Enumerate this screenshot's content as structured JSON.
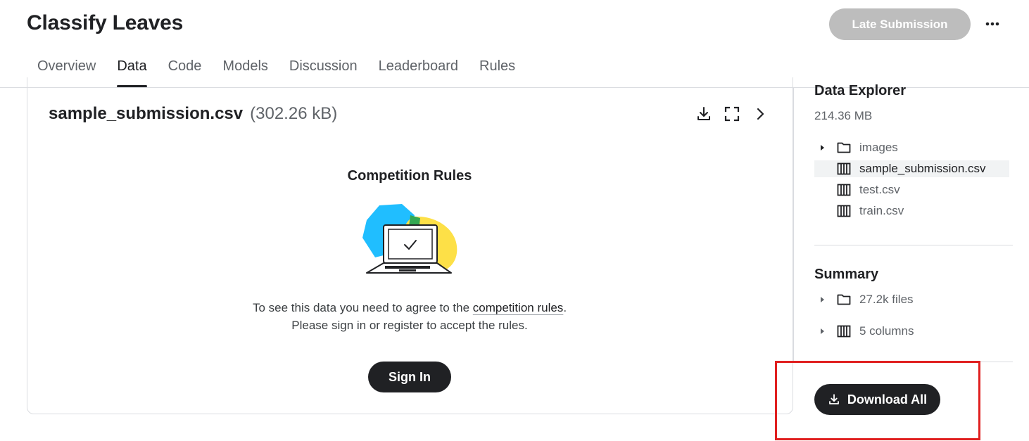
{
  "header": {
    "title": "Classify Leaves",
    "late_submission_label": "Late Submission",
    "more_icon": "more-horizontal-icon"
  },
  "tabs": [
    {
      "label": "Overview",
      "active": false
    },
    {
      "label": "Data",
      "active": true
    },
    {
      "label": "Code",
      "active": false
    },
    {
      "label": "Models",
      "active": false
    },
    {
      "label": "Discussion",
      "active": false
    },
    {
      "label": "Leaderboard",
      "active": false
    },
    {
      "label": "Rules",
      "active": false
    }
  ],
  "file": {
    "name": "sample_submission.csv",
    "size": "(302.26 kB)",
    "actions": [
      "download-icon",
      "fullscreen-icon",
      "chevron-right-icon"
    ]
  },
  "rules_card": {
    "title": "Competition Rules",
    "message_prefix": "To see this data you need to agree to the ",
    "message_link": "competition rules",
    "message_suffix": ".",
    "message_line2": "Please sign in or register to accept the rules.",
    "sign_in_label": "Sign In"
  },
  "data_explorer": {
    "heading": "Data Explorer",
    "size": "214.36 MB",
    "items": [
      {
        "label": "images",
        "icon": "folder-icon",
        "expandable": true,
        "selected": false
      },
      {
        "label": "sample_submission.csv",
        "icon": "table-icon",
        "expandable": false,
        "selected": true
      },
      {
        "label": "test.csv",
        "icon": "table-icon",
        "expandable": false,
        "selected": false
      },
      {
        "label": "train.csv",
        "icon": "table-icon",
        "expandable": false,
        "selected": false
      }
    ]
  },
  "summary": {
    "heading": "Summary",
    "items": [
      {
        "label": "27.2k files",
        "icon": "folder-icon"
      },
      {
        "label": "5 columns",
        "icon": "table-icon"
      }
    ]
  },
  "download_all_label": "Download All",
  "colors": {
    "primary_dark": "#202124",
    "muted_text": "#5f6368",
    "disabled_button": "#bdbdbd",
    "highlight_box": "#e02020",
    "illus_blue": "#20beff",
    "illus_yellow": "#fde047",
    "illus_green": "#34a853"
  }
}
